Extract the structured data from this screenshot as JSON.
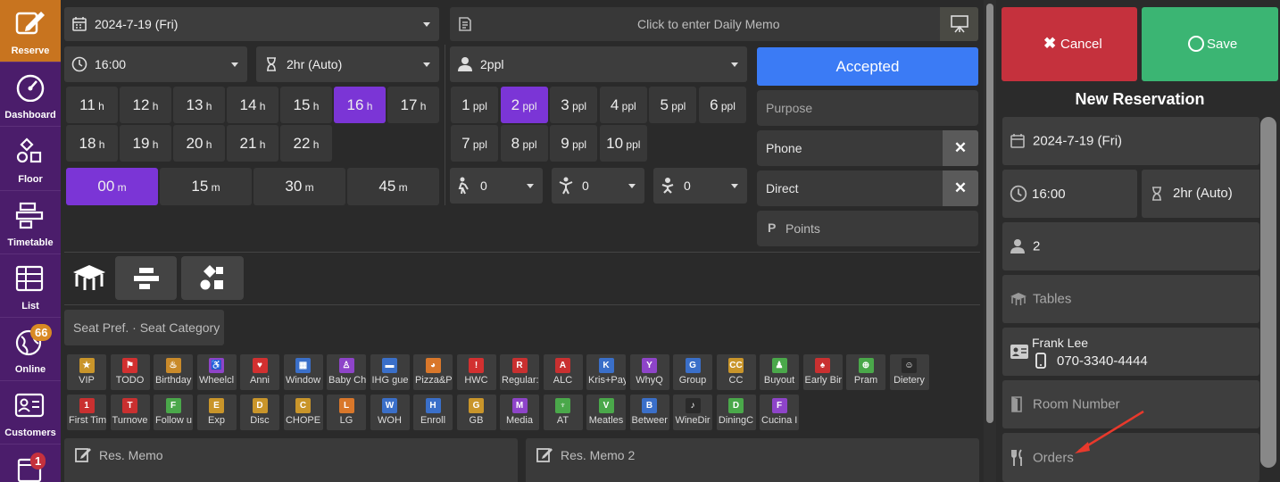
{
  "sidebar": {
    "reserve": "Reserve",
    "dashboard": "Dashboard",
    "floor": "Floor",
    "timetable": "Timetable",
    "list": "List",
    "online": "Online",
    "online_badge": "66",
    "customers": "Customers",
    "bottom_badge": "1"
  },
  "top": {
    "date": "2024-7-19 (Fri)",
    "memo_placeholder": "Click to enter Daily Memo",
    "time": "16:00",
    "duration": "2hr (Auto)",
    "party": "2ppl"
  },
  "hours": [
    {
      "n": "11",
      "u": "h"
    },
    {
      "n": "12",
      "u": "h"
    },
    {
      "n": "13",
      "u": "h"
    },
    {
      "n": "14",
      "u": "h"
    },
    {
      "n": "15",
      "u": "h"
    },
    {
      "n": "16",
      "u": "h"
    },
    {
      "n": "17",
      "u": "h"
    },
    {
      "n": "18",
      "u": "h"
    },
    {
      "n": "19",
      "u": "h"
    },
    {
      "n": "20",
      "u": "h"
    },
    {
      "n": "21",
      "u": "h"
    },
    {
      "n": "22",
      "u": "h"
    }
  ],
  "selected_hour": "16",
  "minutes": [
    {
      "n": "00",
      "u": "m"
    },
    {
      "n": "15",
      "u": "m"
    },
    {
      "n": "30",
      "u": "m"
    },
    {
      "n": "45",
      "u": "m"
    }
  ],
  "selected_minute": "00",
  "people": [
    {
      "n": "1",
      "u": "ppl"
    },
    {
      "n": "2",
      "u": "ppl"
    },
    {
      "n": "3",
      "u": "ppl"
    },
    {
      "n": "4",
      "u": "ppl"
    },
    {
      "n": "5",
      "u": "ppl"
    },
    {
      "n": "6",
      "u": "ppl"
    },
    {
      "n": "7",
      "u": "ppl"
    },
    {
      "n": "8",
      "u": "ppl"
    },
    {
      "n": "9",
      "u": "ppl"
    },
    {
      "n": "10",
      "u": "ppl"
    }
  ],
  "selected_people": "2",
  "kids": {
    "adult_child": "0",
    "child": "0",
    "baby": "0"
  },
  "status": {
    "accepted": "Accepted",
    "purpose": "Purpose",
    "phone": "Phone",
    "direct": "Direct",
    "points": "Points",
    "accent": "#3b7bf5"
  },
  "seat_pref": "Seat Pref. · Seat Category",
  "tags_row1": [
    {
      "label": "VIP",
      "color": "#c9952a",
      "glyph": "★"
    },
    {
      "label": "TODO",
      "color": "#d23030",
      "glyph": "⚑"
    },
    {
      "label": "Birthday",
      "color": "#c98a2a",
      "glyph": "♨"
    },
    {
      "label": "Wheelcl",
      "color": "#8e44c9",
      "glyph": "♿"
    },
    {
      "label": "Anni",
      "color": "#d23030",
      "glyph": "♥"
    },
    {
      "label": "Window",
      "color": "#3a6fc9",
      "glyph": "▦"
    },
    {
      "label": "Baby Ch",
      "color": "#8e44c9",
      "glyph": "♙"
    },
    {
      "label": "IHG gue",
      "color": "#3a6fc9",
      "glyph": "▬"
    },
    {
      "label": "Pizza&P",
      "color": "#d9772a",
      "glyph": "◕"
    },
    {
      "label": "HWC",
      "color": "#d23030",
      "glyph": "!"
    },
    {
      "label": "Regular:",
      "color": "#c93030",
      "glyph": "R"
    },
    {
      "label": "ALC",
      "color": "#c93030",
      "glyph": "A"
    },
    {
      "label": "Kris+Pay",
      "color": "#3a6fc9",
      "glyph": "K"
    },
    {
      "label": "WhyQ",
      "color": "#8e44c9",
      "glyph": "Y"
    },
    {
      "label": "Group",
      "color": "#3a6fc9",
      "glyph": "G"
    },
    {
      "label": "CC",
      "color": "#c9952a",
      "glyph": "CC"
    },
    {
      "label": "Buyout",
      "color": "#4aa84a",
      "glyph": "♟"
    },
    {
      "label": "Early Bir",
      "color": "#c93030",
      "glyph": "♠"
    },
    {
      "label": "Pram",
      "color": "#4aa84a",
      "glyph": "⊕"
    },
    {
      "label": "Dietery",
      "color": "#2a2a2a",
      "glyph": "☺"
    }
  ],
  "tags_row2": [
    {
      "label": "First Tim",
      "color": "#c93030",
      "glyph": "1"
    },
    {
      "label": "Turnove",
      "color": "#c93030",
      "glyph": "T"
    },
    {
      "label": "Follow u",
      "color": "#4aa84a",
      "glyph": "F"
    },
    {
      "label": "Exp",
      "color": "#c9952a",
      "glyph": "E"
    },
    {
      "label": "Disc",
      "color": "#c9952a",
      "glyph": "D"
    },
    {
      "label": "CHOPE",
      "color": "#c9952a",
      "glyph": "C"
    },
    {
      "label": "LG",
      "color": "#d9772a",
      "glyph": "L"
    },
    {
      "label": "WOH",
      "color": "#3a6fc9",
      "glyph": "W"
    },
    {
      "label": "Enroll",
      "color": "#3a6fc9",
      "glyph": "H"
    },
    {
      "label": "GB",
      "color": "#c9952a",
      "glyph": "G"
    },
    {
      "label": "Media",
      "color": "#8e44c9",
      "glyph": "M"
    },
    {
      "label": "AT",
      "color": "#4aa84a",
      "glyph": "♆"
    },
    {
      "label": "Meatles",
      "color": "#4aa84a",
      "glyph": "V"
    },
    {
      "label": "Betweer",
      "color": "#3a6fc9",
      "glyph": "B"
    },
    {
      "label": "WineDir",
      "color": "#2a2a2a",
      "glyph": "♪"
    },
    {
      "label": "DiningC",
      "color": "#4aa84a",
      "glyph": "D"
    },
    {
      "label": "Cucina I",
      "color": "#8e44c9",
      "glyph": "F"
    }
  ],
  "memo": {
    "memo1": "Res. Memo",
    "memo2": "Res. Memo 2"
  },
  "right": {
    "cancel": "Cancel",
    "save": "Save",
    "title": "New Reservation",
    "date": "2024-7-19 (Fri)",
    "time": "16:00",
    "duration": "2hr (Auto)",
    "party": "2",
    "tables": "Tables",
    "guest_name": "Frank Lee",
    "guest_phone": "070-3340-4444",
    "room": "Room Number",
    "orders": "Orders",
    "cancel_color": "#c5313d",
    "save_color": "#3bb573"
  }
}
